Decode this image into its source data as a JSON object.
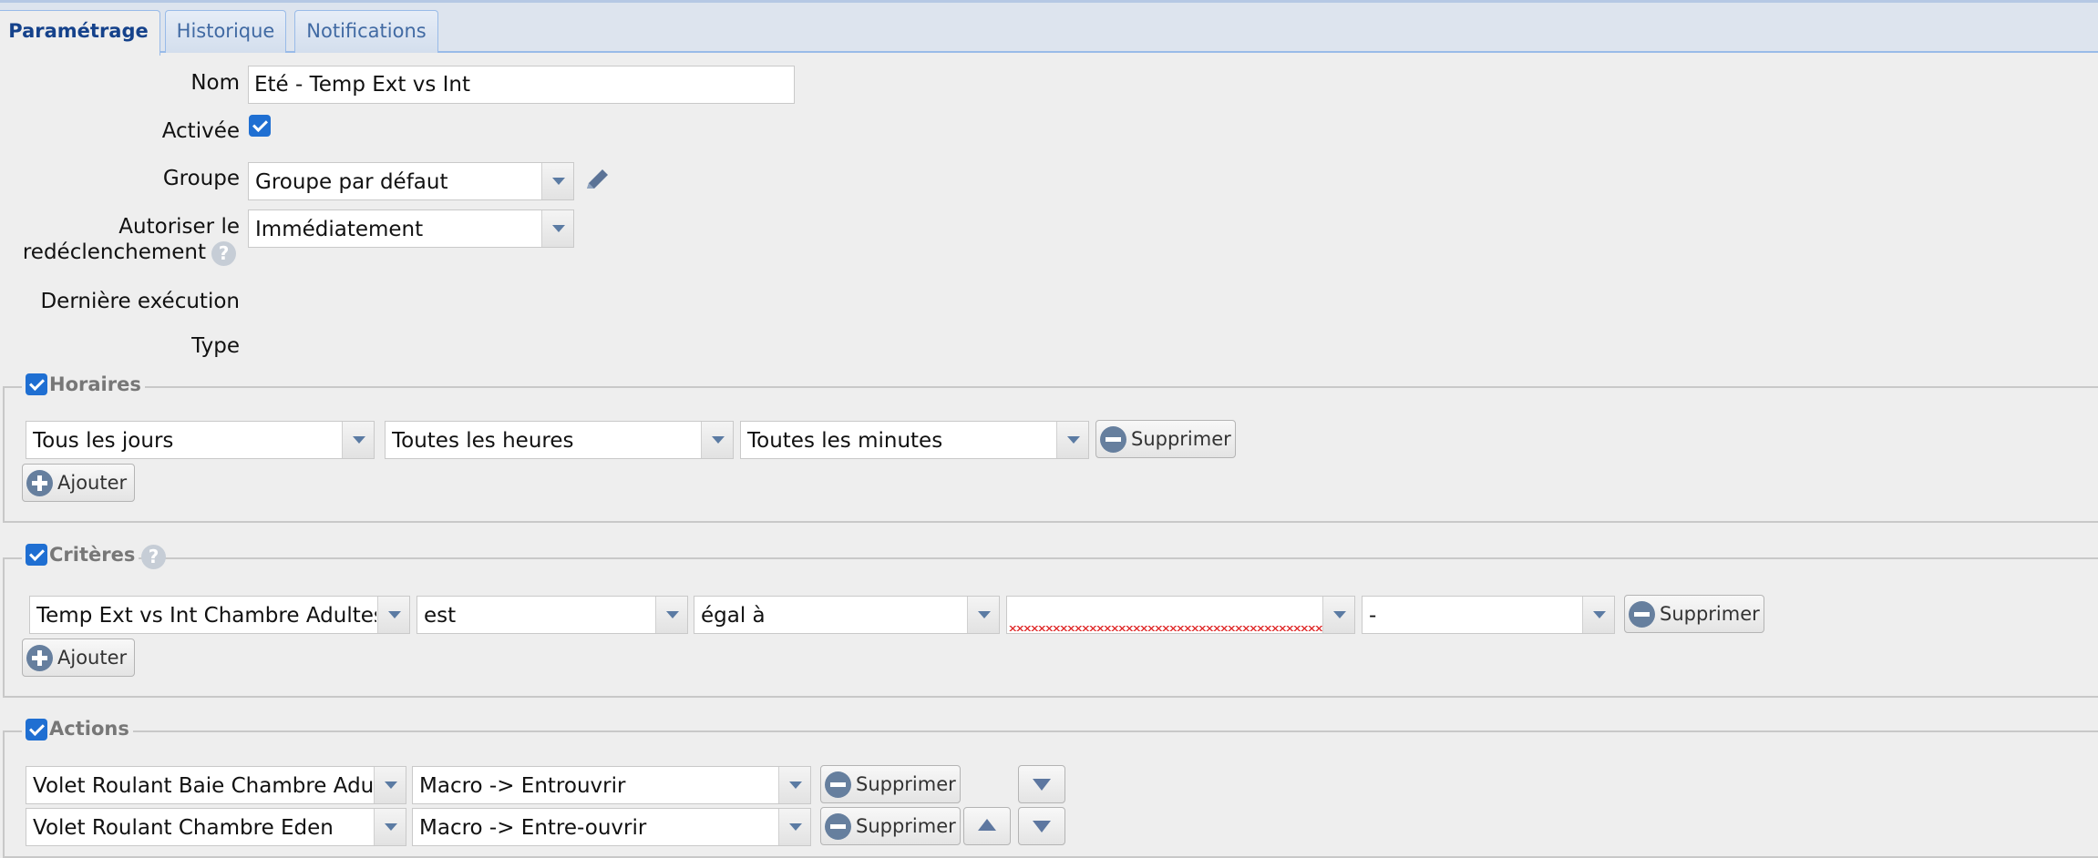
{
  "tabs": [
    {
      "label": "Paramétrage",
      "active": true
    },
    {
      "label": "Historique",
      "active": false
    },
    {
      "label": "Notifications",
      "active": false
    }
  ],
  "form": {
    "nom_label": "Nom",
    "nom_value": "Eté - Temp Ext vs Int",
    "activee_label": "Activée",
    "activee_checked": true,
    "groupe_label": "Groupe",
    "groupe_value": "Groupe par défaut",
    "autoriser_label_1": "Autoriser le",
    "autoriser_label_2": "redéclenchement",
    "autoriser_value": "Immédiatement",
    "derniere_label": "Dernière exécution",
    "type_label": "Type"
  },
  "horaires": {
    "legend": "Horaires",
    "row": [
      "Tous les jours",
      "Toutes les heures",
      "Toutes les minutes"
    ],
    "delete_label": "Supprimer",
    "add_label": "Ajouter"
  },
  "criteres": {
    "legend": "Critères",
    "row": [
      "Temp Ext vs Int Chambre Adultes",
      "est",
      "égal à",
      "",
      "-"
    ],
    "delete_label": "Supprimer",
    "add_label": "Ajouter"
  },
  "actions": {
    "legend": "Actions",
    "rows": [
      {
        "target": "Volet Roulant Baie Chambre Adulte",
        "action": "Macro -> Entrouvrir",
        "delete_label": "Supprimer"
      },
      {
        "target": "Volet Roulant Chambre Eden",
        "action": "Macro -> Entre-ouvrir",
        "delete_label": "Supprimer"
      }
    ]
  },
  "icons": {
    "help": "?",
    "edit": "pencil-icon"
  },
  "colors": {
    "tab_active_text": "#15428b",
    "tab_text": "#416aa3",
    "checkbox": "#1f6fd2",
    "button_icon": "#667f9e"
  }
}
